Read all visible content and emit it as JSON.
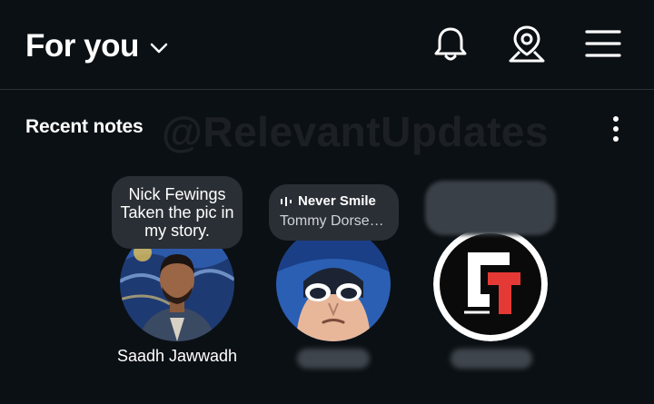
{
  "header": {
    "feed_title": "For you",
    "icons": [
      "chevron-down-icon",
      "bell-icon",
      "map-pin-icon",
      "menu-icon"
    ]
  },
  "watermark": "@RelevantUpdates",
  "section": {
    "title": "Recent notes"
  },
  "notes": [
    {
      "note_text": "Nick Fewings Taken the pic in my story.",
      "name": "Saadh Jawwadh"
    },
    {
      "music_title": "Never Smile",
      "music_artist": "Tommy Dorse…",
      "name": ""
    },
    {
      "name": ""
    }
  ],
  "colors": {
    "background": "#0b1014",
    "bubble": "#2a2f35",
    "brand_red": "#e53935"
  }
}
